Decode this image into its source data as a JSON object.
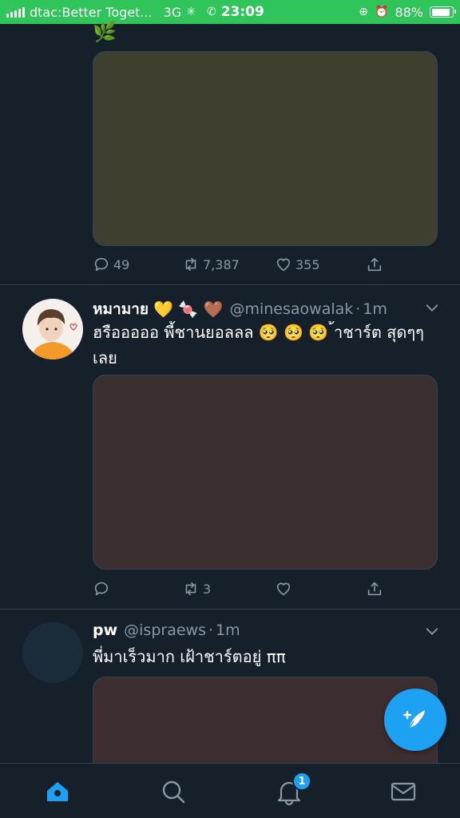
{
  "status_bar": {
    "carrier": "dtac:Better Toget...",
    "network": "3G",
    "time": "23:09",
    "battery": "88%",
    "battery_level": 0.88,
    "color": "#2fc55a"
  },
  "colors": {
    "background": "#15202b",
    "accent": "#1da1f2",
    "muted": "#8899a6",
    "border": "#38444d"
  },
  "tweets": [
    {
      "partial_top": true,
      "leaf_emoji": "🌿",
      "media_color": "#3e3f2e",
      "actions": {
        "replies": "49",
        "retweets": "7,387",
        "likes": "355"
      }
    },
    {
      "name": "หมามาย",
      "name_emojis": "💛 🍬 🤎",
      "handle": "@minesaowalak",
      "time": "1m",
      "text": "ฮรือออออ พี้ชานยอลลล 🥺 🥺 🥺  ้าชาร์ต สุดๆๆเลย",
      "media_color": "#3b2e30",
      "actions": {
        "replies": "",
        "retweets": "3",
        "likes": ""
      }
    },
    {
      "name": "pw",
      "handle": "@ispraews",
      "time": "1m",
      "text": "พี่มาเร็วมาก เฝ้าชาร์ตอยู่ ππ",
      "media_color": "#3c2e30"
    }
  ],
  "tabbar": {
    "items": [
      "home-icon",
      "search-icon",
      "notifications-icon",
      "messages-icon"
    ],
    "notification_count": "1"
  },
  "fab": {
    "icon": "compose-tweet-icon"
  }
}
